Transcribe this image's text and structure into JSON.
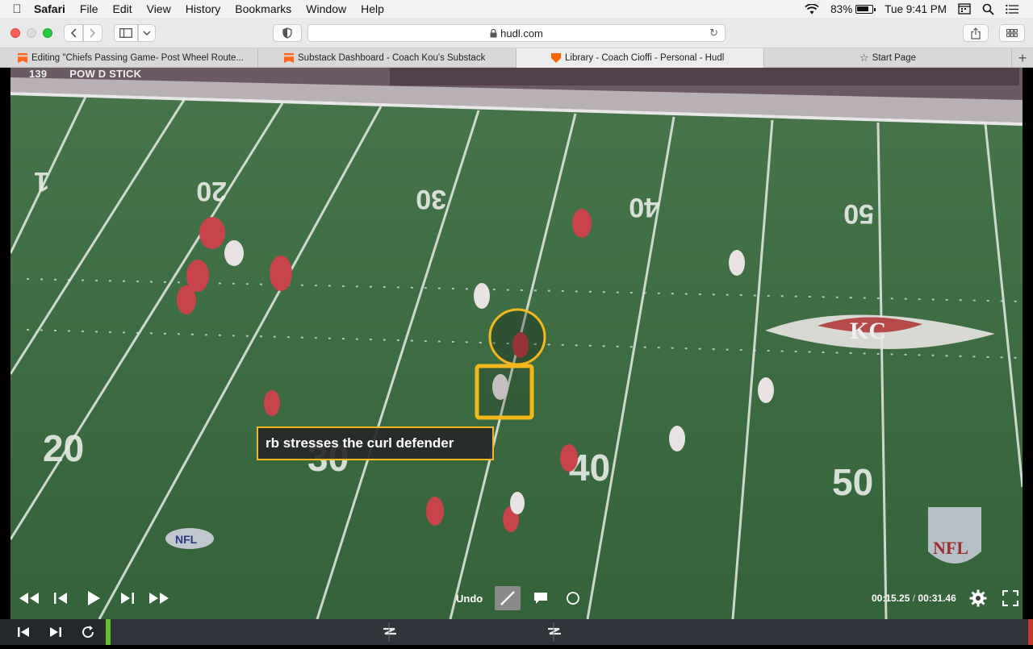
{
  "menubar": {
    "app_name": "Safari",
    "menus": [
      "File",
      "Edit",
      "View",
      "History",
      "Bookmarks",
      "Window",
      "Help"
    ],
    "battery": "83%",
    "clock": "Tue 9:41 PM"
  },
  "toolbar": {
    "url": "hudl.com"
  },
  "tabs": [
    {
      "label": "Editing \"Chiefs Passing Game- Post Wheel Route...",
      "icon": "substack-icon",
      "active": false
    },
    {
      "label": "Substack Dashboard - Coach Kou's Substack",
      "icon": "substack-icon",
      "active": false
    },
    {
      "label": "Library - Coach Cioffi - Personal - Hudl",
      "icon": "hudl-icon",
      "active": true
    },
    {
      "label": "Start Page",
      "icon": "star-icon",
      "active": false
    }
  ],
  "video": {
    "clip_number": "139",
    "clip_name": "POW D STICK",
    "annotation_text": "rb stresses the curl defender",
    "yard_numbers": [
      "20",
      "30",
      "40",
      "50",
      "20",
      "30",
      "40",
      "50",
      "1"
    ],
    "field_logo": "NFL",
    "team_logo": "KC"
  },
  "controls": {
    "undo_label": "Undo",
    "current_time": "00:15.25",
    "separator": " / ",
    "total_time": "00:31.46",
    "active_tool": "line"
  },
  "colors": {
    "field_green": "#3d6f3c",
    "annotation_yellow": "#f4b81c",
    "timeline_bg": "#24292e",
    "playhead_green": "#5fbf2a"
  }
}
